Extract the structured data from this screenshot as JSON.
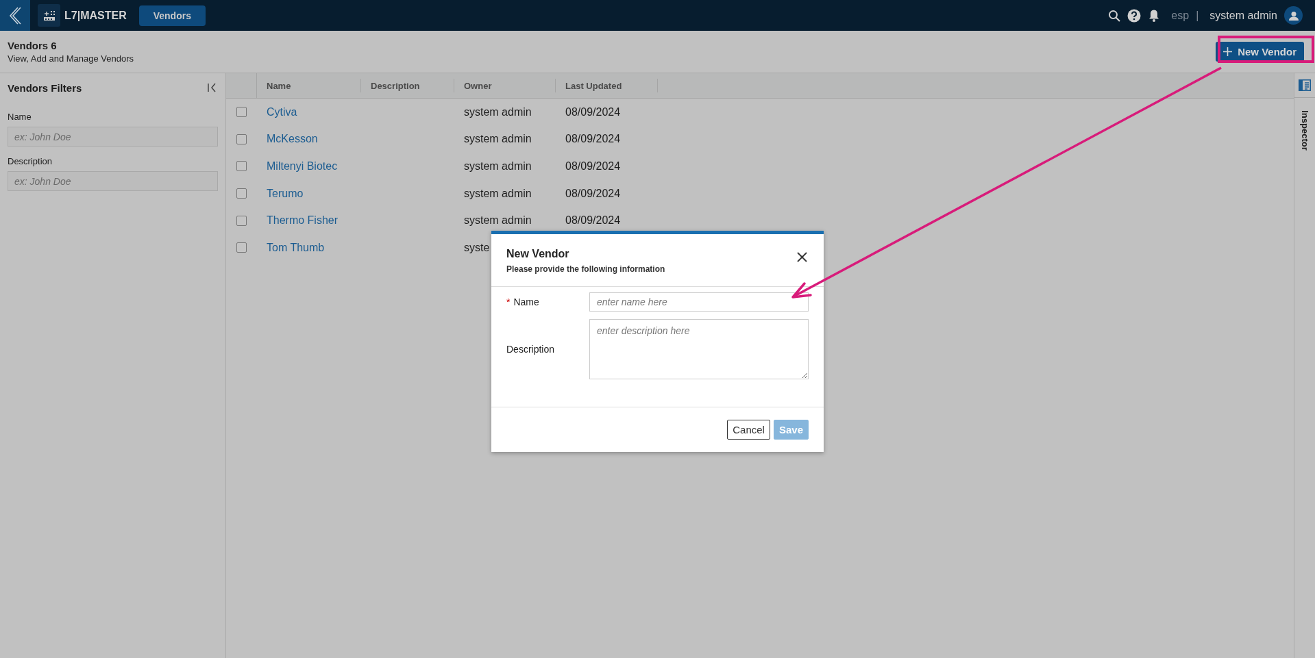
{
  "topbar": {
    "app_name": "L7|MASTER",
    "tabs": [
      {
        "label": "Vendors",
        "selected": true
      }
    ],
    "language": "esp",
    "separator": "|",
    "user": "system admin"
  },
  "page_header": {
    "title": "Vendors 6",
    "subtitle": "View, Add and Manage Vendors",
    "action_button": "New Vendor"
  },
  "filters": {
    "title": "Vendors Filters",
    "fields": [
      {
        "label": "Name",
        "placeholder": "ex: John Doe"
      },
      {
        "label": "Description",
        "placeholder": "ex: John Doe"
      }
    ]
  },
  "table": {
    "columns": [
      "Name",
      "Description",
      "Owner",
      "Last Updated"
    ],
    "rows": [
      {
        "checked": false,
        "name": "Cytiva",
        "owner": "system admin",
        "last_updated": "08/09/2024"
      },
      {
        "checked": false,
        "name": "McKesson",
        "owner": "system admin",
        "last_updated": "08/09/2024"
      },
      {
        "checked": false,
        "name": "Miltenyi Biotec",
        "owner": "system admin",
        "last_updated": "08/09/2024"
      },
      {
        "checked": false,
        "name": "Terumo",
        "owner": "system admin",
        "last_updated": "08/09/2024"
      },
      {
        "checked": false,
        "name": "Thermo Fisher",
        "owner": "system admin",
        "last_updated": "08/09/2024"
      },
      {
        "checked": false,
        "name": "Tom Thumb",
        "owner": "syste"
      }
    ]
  },
  "inspector": {
    "label": "Inspector"
  },
  "dialog": {
    "title": "New Vendor",
    "subtitle": "Please provide the following information",
    "fields": [
      {
        "kind": "input",
        "label": "Name",
        "required": true,
        "marker": "*",
        "placeholder": "enter name here"
      },
      {
        "kind": "textarea",
        "label": "Description",
        "required": false,
        "placeholder": "enter description here"
      }
    ],
    "buttons": [
      {
        "label": "Cancel",
        "kind": "secondary",
        "disabled": false
      },
      {
        "label": "Save",
        "kind": "primary",
        "disabled": true
      }
    ]
  }
}
